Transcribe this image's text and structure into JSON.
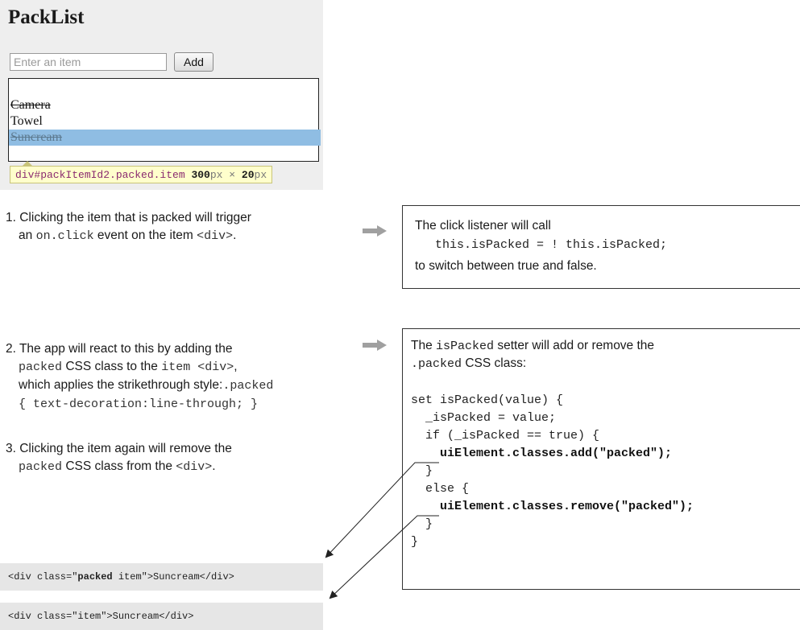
{
  "app": {
    "title": "PackList",
    "input_placeholder": "Enter an item",
    "add_label": "Add",
    "items": [
      {
        "label": "Camera",
        "packed": true
      },
      {
        "label": "Towel",
        "packed": false
      },
      {
        "label": "Suncream",
        "packed": true,
        "highlighted": true
      }
    ],
    "tooltip": {
      "selector": "div#packItemId2.packed.item",
      "width": "300",
      "width_unit": "px",
      "times": "×",
      "height": "20",
      "height_unit": "px"
    }
  },
  "steps": {
    "s1_line1": "1. Clicking the item that is packed will trigger",
    "s1_line2_pre": "an ",
    "s1_line2_code": "on.click",
    "s1_line2_mid": " event on the item ",
    "s1_line2_code2": "<div>",
    "s1_line2_post": ".",
    "s2_line1": "2. The app will react to this by adding the",
    "s2_line2_code": "packed",
    "s2_line2_mid": " CSS class to the ",
    "s2_line2_code2": "item <div>",
    "s2_line2_post": ",",
    "s2_line3_pre": "which applies the strikethrough style:",
    "s2_line3_code": ".packed",
    "s2_line4_code": "{ text-decoration:line-through; }",
    "s3_line1": "3. Clicking the item again will remove the",
    "s3_line2_code": "packed",
    "s3_line2_mid": " CSS class from the ",
    "s3_line2_code2": "<div>",
    "s3_line2_post": "."
  },
  "note1": {
    "line1": "The click listener will call",
    "line2": "this.isPacked = ! this.isPacked;",
    "line3": "to switch between true and false."
  },
  "note2": {
    "line1_pre": "The ",
    "line1_code": "isPacked",
    "line1_post": " setter will add or remove the",
    "line2_code": ".packed",
    "line2_post": " CSS class:",
    "code": [
      "set isPacked(value) {",
      "  _isPacked = value;",
      "  if (_isPacked == true) {",
      "    uiElement.classes.add(\"packed\");",
      "  }",
      "  else {",
      "    uiElement.classes.remove(\"packed\");",
      "  }",
      "}"
    ]
  },
  "html_examples": {
    "packed_pre": "<div class=\"",
    "packed_bold": "packed",
    "packed_post": " item\">Suncream</div>",
    "unpacked": "<div class=\"item\">Suncream</div>"
  },
  "colors": {
    "highlight": "#8fbde3",
    "arrow": "#a0a0a0",
    "tooltip_bg": "#ffffcc",
    "code_bg": "#e6e6e6"
  }
}
